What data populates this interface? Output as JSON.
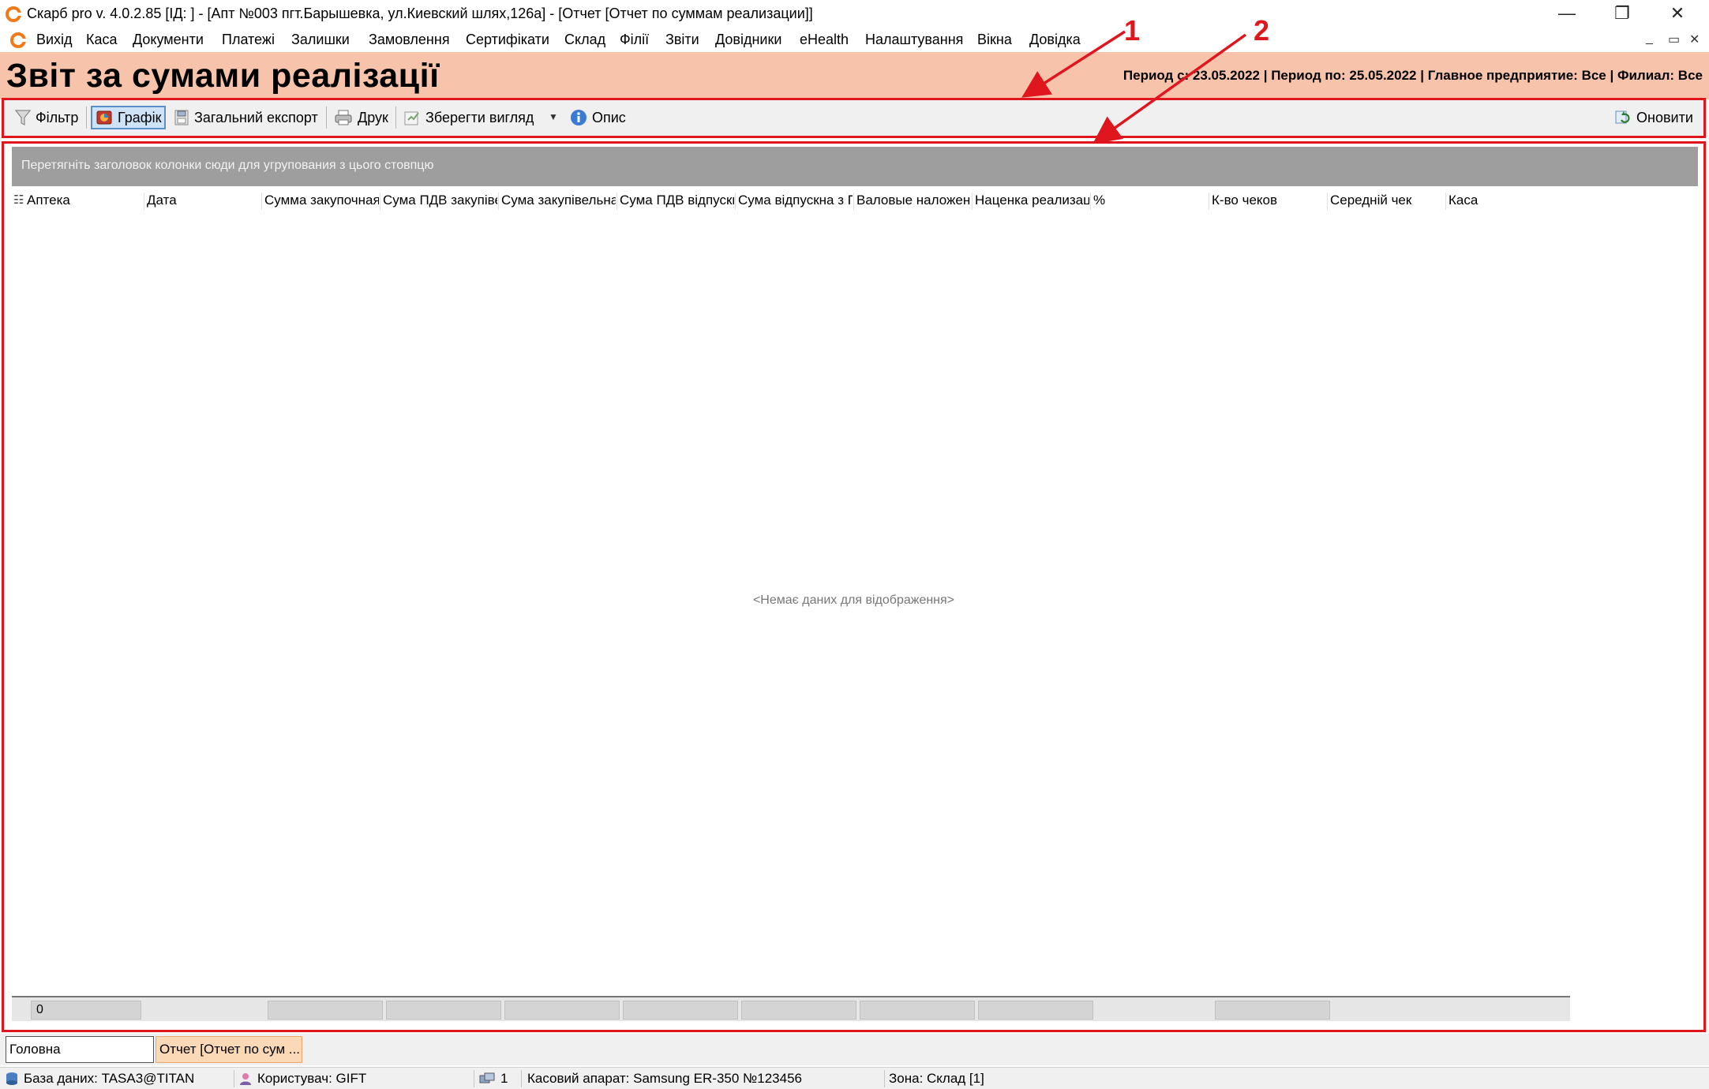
{
  "window": {
    "title": "Скарб pro v. 4.0.2.85 [ІД:       ] - [Апт №003 пгт.Барышевка, ул.Киевский шлях,126а] - [Отчет [Отчет по суммам реализации]]",
    "minimize": "—",
    "restore": "❐",
    "close": "✕"
  },
  "menu": {
    "items": [
      "Вихід",
      "Каса",
      "Документи",
      "Платежі",
      "Залишки",
      "Замовлення",
      "Сертифікати",
      "Склад",
      "Філії",
      "Звіти",
      "Довідники",
      "eHealth",
      "Налаштування",
      "Вікна",
      "Довідка"
    ],
    "mdi_minimize": "_",
    "mdi_restore": "▭",
    "mdi_close": "✕"
  },
  "header": {
    "title": "Звіт за сумами реалізації",
    "params": "Период с: 23.05.2022 | Период по: 25.05.2022 | Главное предприятие: Все | Филиал: Все"
  },
  "toolbar": {
    "filter": "Фільтр",
    "chart": "Графік",
    "export": "Загальний експорт",
    "print": "Друк",
    "save_view": "Зберегти вигляд",
    "description": "Опис",
    "refresh": "Оновити"
  },
  "grid": {
    "group_hint": "Перетягніть заголовок колонки сюди для угрупования з цього стовпцю",
    "columns": [
      "Аптека",
      "Дата",
      "Сумма закупочная",
      "Сума ПДВ закупівельна",
      "Сума закупівельна",
      "Сума ПДВ відпускна",
      "Сума відпускна з ПДВ",
      "Валовые наложения",
      "Наценка реализации",
      "%",
      "К-во чеков",
      "Середній чек",
      "Каса"
    ],
    "empty_text": "<Немає даних для відображення>",
    "footer_count": "0"
  },
  "tabs": [
    {
      "label": "Головна"
    },
    {
      "label": "Отчет [Отчет по сум ..."
    }
  ],
  "status": {
    "database": "База даних: TASA3@TITAN",
    "user": "Користувач: GIFT",
    "count": "1",
    "cash_register": "Касовий апарат: Samsung ER-350 №123456",
    "zone": "Зона: Склад [1]"
  },
  "annotations": {
    "label_1": "1",
    "label_2": "2"
  },
  "colors": {
    "header_bg": "#f7c4ab",
    "annotation": "#e0161e",
    "group_bar": "#9e9e9e",
    "active_tab": "#fcd9b6"
  }
}
